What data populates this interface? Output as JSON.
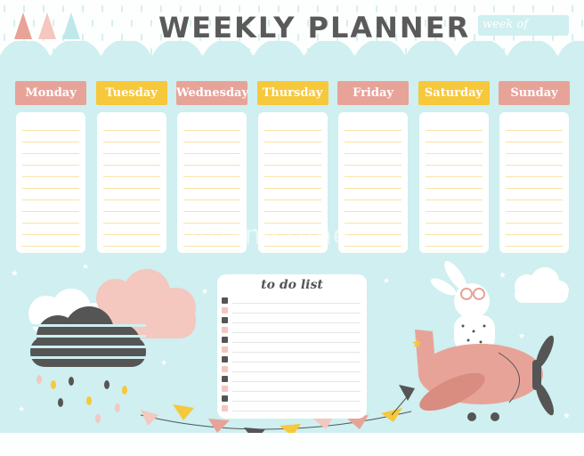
{
  "header": {
    "title": "WEEKLY PLANNER",
    "week_label": "week of"
  },
  "days": [
    {
      "label": "Monday",
      "color": "#e8a398"
    },
    {
      "label": "Tuesday",
      "color": "#f6c83b"
    },
    {
      "label": "Wednesday",
      "color": "#e8a398"
    },
    {
      "label": "Thursday",
      "color": "#f6c83b"
    },
    {
      "label": "Friday",
      "color": "#e8a398"
    },
    {
      "label": "Saturday",
      "color": "#f6c83b"
    },
    {
      "label": "Sunday",
      "color": "#e8a398"
    }
  ],
  "todo": {
    "title": "to do list",
    "bullet_colors": [
      "#555555",
      "#f4c7bf",
      "#555555",
      "#f4c7bf",
      "#555555",
      "#f4c7bf",
      "#555555",
      "#f4c7bf",
      "#555555",
      "#f4c7bf",
      "#555555",
      "#f4c7bf"
    ]
  },
  "watermark": "dreamstime",
  "colors": {
    "mint": "#cfeff0",
    "coral": "#e8a398",
    "yellow": "#f6c83b",
    "charcoal": "#555555",
    "pink": "#f4c7bf"
  },
  "icons": [
    "flag-icon",
    "cloud-icon",
    "rain-cloud-icon",
    "bunny-plane-illustration",
    "bunting-icon",
    "star-icon"
  ]
}
